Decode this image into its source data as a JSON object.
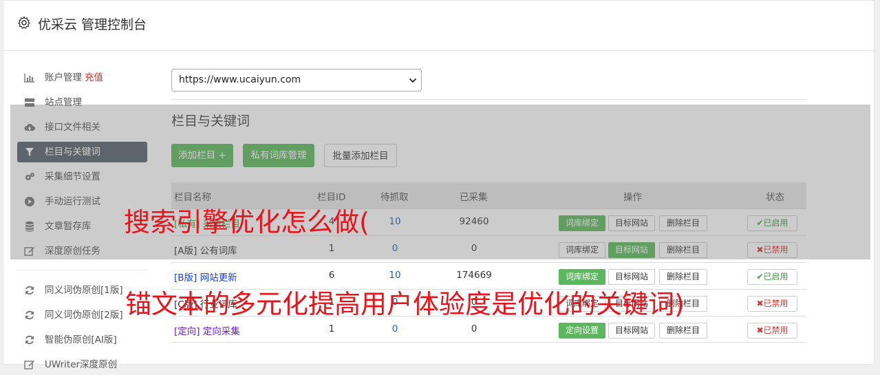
{
  "header": {
    "title": "优采云 管理控制台",
    "icon": "gear-icon"
  },
  "sidebar": {
    "items": [
      {
        "label": "账户管理",
        "extra": "充值",
        "icon": "bar-chart-icon"
      },
      {
        "label": "站点管理",
        "icon": "server-icon"
      },
      {
        "label": "接口文件相关",
        "icon": "cloud-upload-icon"
      },
      {
        "label": "栏目与关键词",
        "icon": "filter-icon",
        "active": true
      },
      {
        "label": "采集细节设置",
        "icon": "cogs-icon"
      },
      {
        "label": "手动运行测试",
        "icon": "play-circle-icon"
      },
      {
        "label": "文章暂存库",
        "icon": "database-icon"
      },
      {
        "label": "深度原创任务",
        "icon": "edit-icon"
      },
      {
        "label": "同义词伪原创[1版]",
        "icon": "refresh-icon"
      },
      {
        "label": "同义词伪原创[2版]",
        "icon": "refresh-icon"
      },
      {
        "label": "智能伪原创[AI版]",
        "icon": "refresh-icon"
      },
      {
        "label": "UWriter深度原创",
        "icon": "edit-icon"
      }
    ]
  },
  "site_select": {
    "value": "https://www.ucaiyun.com"
  },
  "section": {
    "title": "栏目与关键词"
  },
  "toolbar": {
    "add_column": "添加栏目 +",
    "private_lib": "私有词库管理",
    "batch_add": "批量添加栏目"
  },
  "table": {
    "headers": [
      "栏目名称",
      "栏目ID",
      "待抓取",
      "已采集",
      "操作",
      "状态"
    ],
    "rows": [
      {
        "prefix": "[私有]",
        "name": "采集栏目",
        "id": "4",
        "pending": "10",
        "collected": "92460",
        "op1": "词库绑定",
        "op2": "目标网站",
        "op3": "删除栏目",
        "status": "已启用",
        "enabled": true,
        "color": "#3c9a3c"
      },
      {
        "prefix": "[A版]",
        "name": "公有词库",
        "id": "1",
        "pending": "0",
        "collected": "0",
        "op1": "词库绑定",
        "op2": "目标网站",
        "op3": "删除栏目",
        "status": "已禁用",
        "enabled": false,
        "color": "#333333"
      },
      {
        "prefix": "[B版]",
        "name": "网站更新",
        "id": "6",
        "pending": "10",
        "collected": "174669",
        "op1": "词库绑定",
        "op2": "目标网站",
        "op3": "删除栏目",
        "status": "已启用",
        "enabled": true,
        "color": "#1a3fd6"
      },
      {
        "prefix": "[C版]",
        "name": "行业词库",
        "id": "1",
        "pending": "0",
        "collected": "0",
        "op1": "词库绑定",
        "op2": "目标网站",
        "op3": "删除栏目",
        "status": "已禁用",
        "enabled": false,
        "color": "#333333"
      },
      {
        "prefix": "[定向]",
        "name": "定向采集",
        "id": "1",
        "pending": "0",
        "collected": "0",
        "op1": "定向设置",
        "op2": "目标网站",
        "op3": "删除栏目",
        "status": "已禁用",
        "enabled": false,
        "color": "#6a1fc9"
      }
    ]
  },
  "overlay_text": {
    "line1": "搜索引擎优化怎么做(",
    "line2": "锚文本的多元化提高用户体验度是优化的关键词)"
  }
}
